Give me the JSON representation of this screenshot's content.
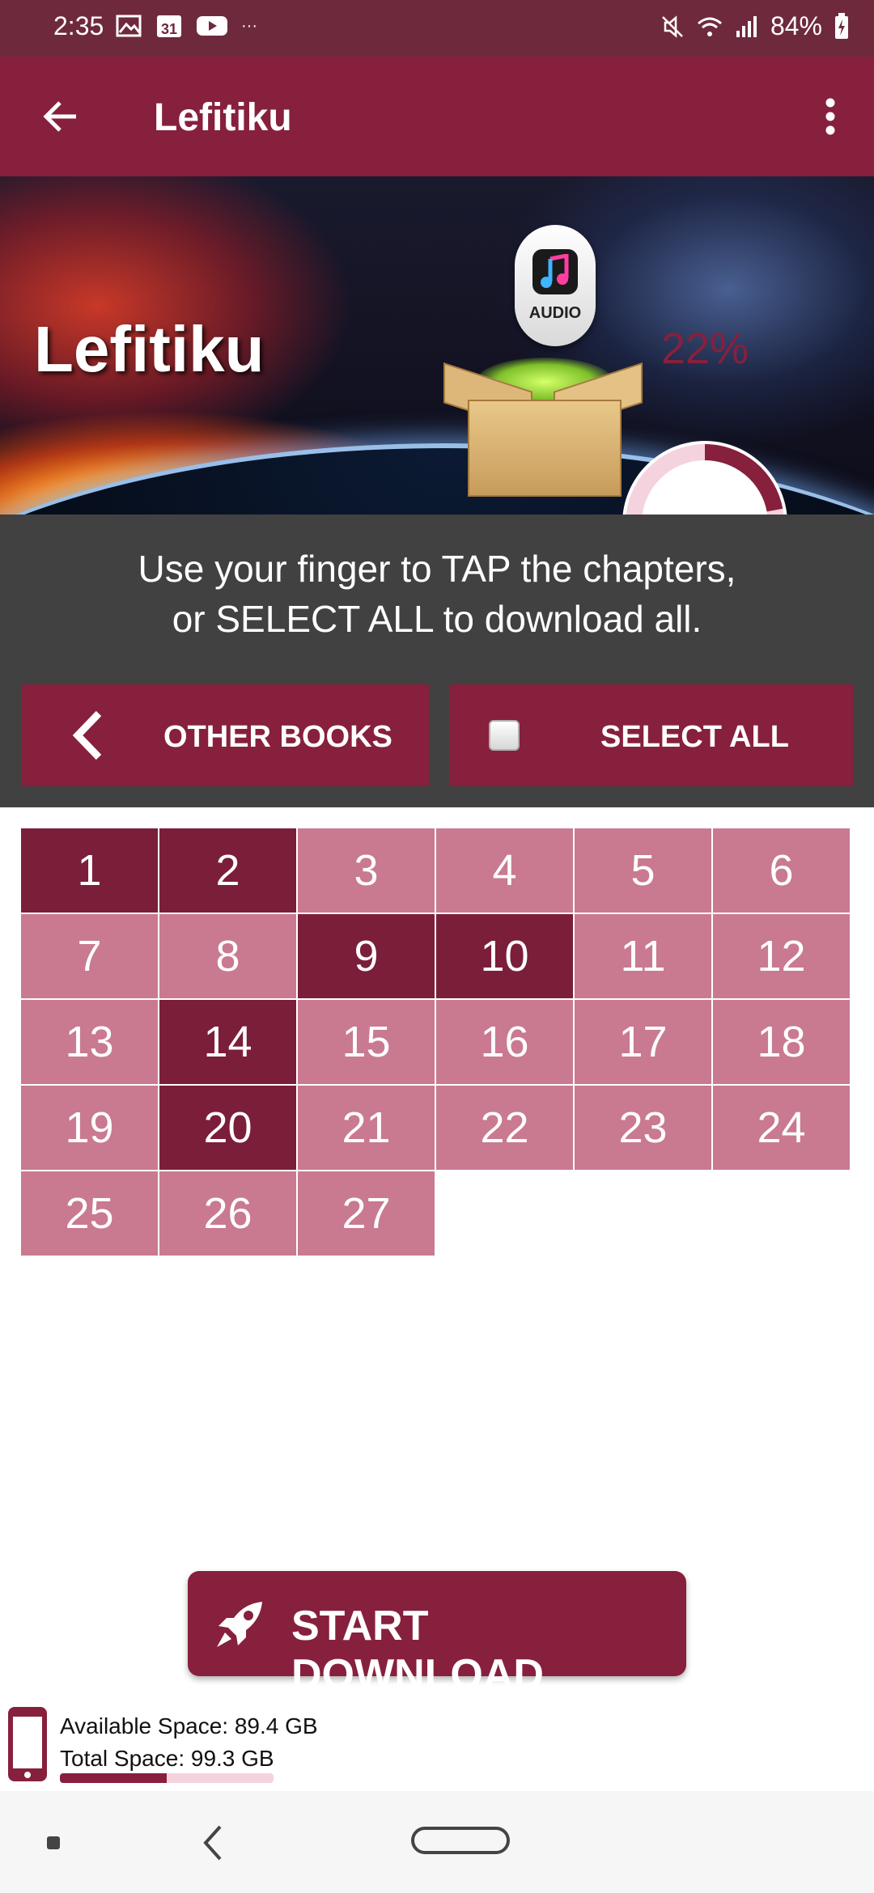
{
  "status_bar": {
    "time": "2:35",
    "battery": "84%",
    "left_icons": [
      "image-icon",
      "calendar-icon",
      "youtube-icon",
      "more-dots-icon"
    ],
    "calendar_day": "31",
    "right_icons": [
      "mute-icon",
      "wifi-icon",
      "signal-icon",
      "battery-icon"
    ]
  },
  "app_bar": {
    "title": "Lefitiku",
    "back_icon": "arrow-left-icon",
    "menu_icon": "more-vert-icon"
  },
  "banner": {
    "title": "Lefitiku",
    "audio_label": "AUDIO",
    "progress_text": "22%",
    "progress_value": 0.22
  },
  "instructions": {
    "line1": "Use your finger to TAP the chapters,",
    "line2": "or SELECT ALL to download all."
  },
  "buttons": {
    "other_books": "OTHER BOOKS",
    "select_all": "SELECT ALL",
    "start_download": "START DOWNLOAD"
  },
  "chapters": [
    {
      "num": "1",
      "selected": true
    },
    {
      "num": "2",
      "selected": true
    },
    {
      "num": "3",
      "selected": false
    },
    {
      "num": "4",
      "selected": false
    },
    {
      "num": "5",
      "selected": false
    },
    {
      "num": "6",
      "selected": false
    },
    {
      "num": "7",
      "selected": false
    },
    {
      "num": "8",
      "selected": false
    },
    {
      "num": "9",
      "selected": true
    },
    {
      "num": "10",
      "selected": true
    },
    {
      "num": "11",
      "selected": false
    },
    {
      "num": "12",
      "selected": false
    },
    {
      "num": "13",
      "selected": false
    },
    {
      "num": "14",
      "selected": true
    },
    {
      "num": "15",
      "selected": false
    },
    {
      "num": "16",
      "selected": false
    },
    {
      "num": "17",
      "selected": false
    },
    {
      "num": "18",
      "selected": false
    },
    {
      "num": "19",
      "selected": false
    },
    {
      "num": "20",
      "selected": true
    },
    {
      "num": "21",
      "selected": false
    },
    {
      "num": "22",
      "selected": false
    },
    {
      "num": "23",
      "selected": false
    },
    {
      "num": "24",
      "selected": false
    },
    {
      "num": "25",
      "selected": false
    },
    {
      "num": "26",
      "selected": false
    },
    {
      "num": "27",
      "selected": false
    }
  ],
  "storage": {
    "available": "Available Space: 89.4 GB",
    "total": "Total Space: 99.3 GB",
    "used_fraction": 0.5
  },
  "colors": {
    "primary": "#87203d",
    "status_bar": "#6e2a3c",
    "chapter_selected": "#7b1e3a",
    "chapter_unselected": "#c97a90",
    "instruction_bg": "#414141"
  }
}
